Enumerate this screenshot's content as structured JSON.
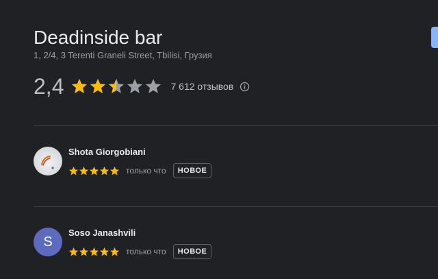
{
  "place": {
    "name": "Deadinside bar",
    "address": "1, 2/4, 3 Terenti Graneli Street, Tbilisi, Грузия",
    "rating": "2,4",
    "rating_numeric": 2.4,
    "rating_max": 5,
    "review_count": "7 612 отзывов"
  },
  "icons": {
    "info": "info-icon",
    "star": "star-icon"
  },
  "colors": {
    "background": "#202124",
    "star_filled": "#fbbc04",
    "star_empty": "#9aa0a6",
    "accent_button": "#8ab4f8",
    "avatar_letter_bg": "#5c6bc0"
  },
  "reviews": [
    {
      "author": "Shota Giorgobiani",
      "avatar_type": "photo",
      "rating": 5,
      "time": "только что",
      "badge": "НОВОЕ"
    },
    {
      "author": "Soso Janashvili",
      "avatar_type": "letter",
      "avatar_letter": "S",
      "rating": 5,
      "time": "только что",
      "badge": "НОВОЕ"
    }
  ]
}
